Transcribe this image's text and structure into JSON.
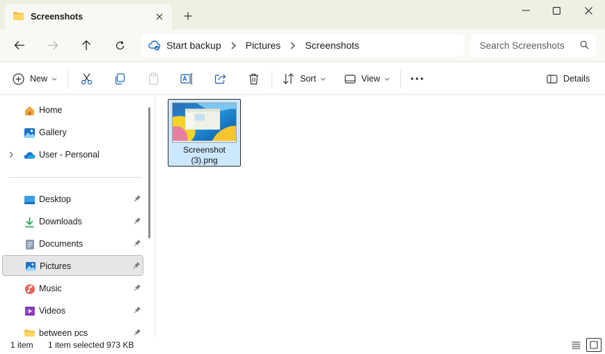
{
  "window": {
    "tab_title": "Screenshots",
    "new_tab_label": "+"
  },
  "address": {
    "crumbs": [
      "Start backup",
      "Pictures",
      "Screenshots"
    ]
  },
  "search": {
    "placeholder": "Search Screenshots"
  },
  "toolbar": {
    "new_label": "New",
    "sort_label": "Sort",
    "view_label": "View",
    "details_label": "Details"
  },
  "sidebar": {
    "top_items": [
      {
        "label": "Home",
        "icon": "home-icon"
      },
      {
        "label": "Gallery",
        "icon": "gallery-icon"
      },
      {
        "label": "User - Personal",
        "icon": "onedrive-cloud-icon"
      }
    ],
    "quick_access": [
      {
        "label": "Desktop",
        "icon": "desktop-icon",
        "pinned": true
      },
      {
        "label": "Downloads",
        "icon": "download-icon",
        "pinned": true
      },
      {
        "label": "Documents",
        "icon": "documents-icon",
        "pinned": true
      },
      {
        "label": "Pictures",
        "icon": "pictures-icon",
        "pinned": true,
        "selected": true
      },
      {
        "label": "Music",
        "icon": "music-icon",
        "pinned": true
      },
      {
        "label": "Videos",
        "icon": "videos-icon",
        "pinned": true
      },
      {
        "label": "between pcs",
        "icon": "folder-icon",
        "pinned": true
      }
    ]
  },
  "files": [
    {
      "name": "Screenshot (3).png",
      "name_line1": "Screenshot",
      "name_line2": "(3).png",
      "selected": true
    }
  ],
  "status": {
    "item_count": "1 item",
    "selection": "1 item selected",
    "size": "973 KB"
  },
  "colors": {
    "titlebar_bg": "#eef0e4",
    "selection_bg": "#cce8ff",
    "accent": "#0067c0"
  }
}
